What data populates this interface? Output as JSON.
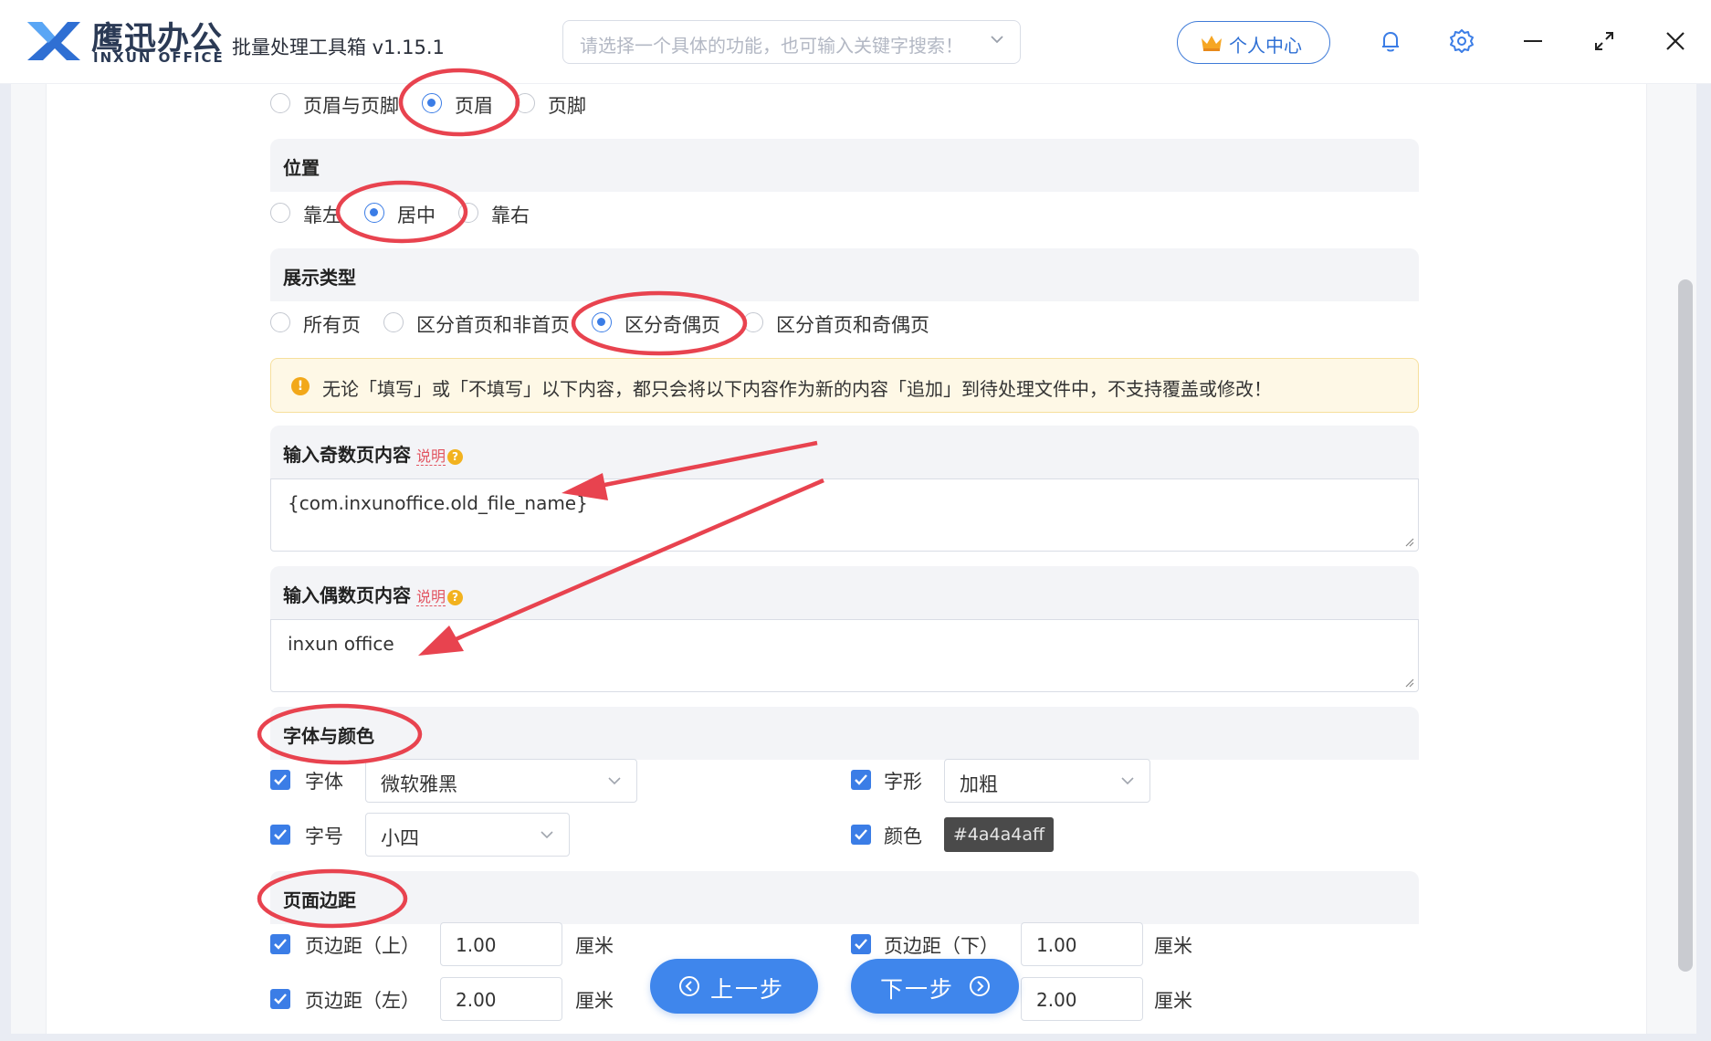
{
  "app": {
    "brand_cn": "鹰迅办公",
    "brand_en": "INXUN OFFICE",
    "title": "批量处理工具箱 v1.15.1"
  },
  "search": {
    "placeholder": "请选择一个具体的功能，也可输入关键字搜索！"
  },
  "user_center": {
    "label": "个人中心"
  },
  "header_footer": {
    "options": [
      "页眉与页脚",
      "页眉",
      "页脚"
    ],
    "selected": "页眉"
  },
  "position": {
    "title": "位置",
    "options": [
      "靠左",
      "居中",
      "靠右"
    ],
    "selected": "居中"
  },
  "display_type": {
    "title": "展示类型",
    "options": [
      "所有页",
      "区分首页和非首页",
      "区分奇偶页",
      "区分首页和奇偶页"
    ],
    "selected": "区分奇偶页"
  },
  "notice": {
    "icon": "!",
    "text": "无论「填写」或「不填写」以下内容，都只会将以下内容作为新的内容「追加」到待处理文件中，不支持覆盖或修改！"
  },
  "odd_page": {
    "title": "输入奇数页内容",
    "help": "说明",
    "value": "{com.inxunoffice.old_file_name}"
  },
  "even_page": {
    "title": "输入偶数页内容",
    "help": "说明",
    "value": "inxun office"
  },
  "font_color": {
    "title": "字体与颜色",
    "font_label": "字体",
    "font_value": "微软雅黑",
    "style_label": "字形",
    "style_value": "加粗",
    "size_label": "字号",
    "size_value": "小四",
    "color_label": "颜色",
    "color_value": "#4a4a4aff"
  },
  "margins": {
    "title": "页面边距",
    "top_label": "页边距（上）",
    "top_value": "1.00",
    "bottom_label": "页边距（下）",
    "bottom_value": "1.00",
    "left_label": "页边距（左）",
    "left_value": "2.00",
    "right_value": "2.00",
    "unit": "厘米"
  },
  "nav": {
    "prev": "上一步",
    "next": "下一步"
  },
  "colors": {
    "accent": "#3f86ec",
    "annotation": "#e8434f",
    "color_chip": "#4a4a4a"
  },
  "icons": [
    "logo-icon",
    "search-chevron-icon",
    "crown-icon",
    "bell-icon",
    "gear-icon",
    "minimize-icon",
    "maximize-icon",
    "close-icon",
    "chevron-down-icon",
    "check-icon",
    "prev-arrow-icon",
    "next-arrow-icon"
  ]
}
